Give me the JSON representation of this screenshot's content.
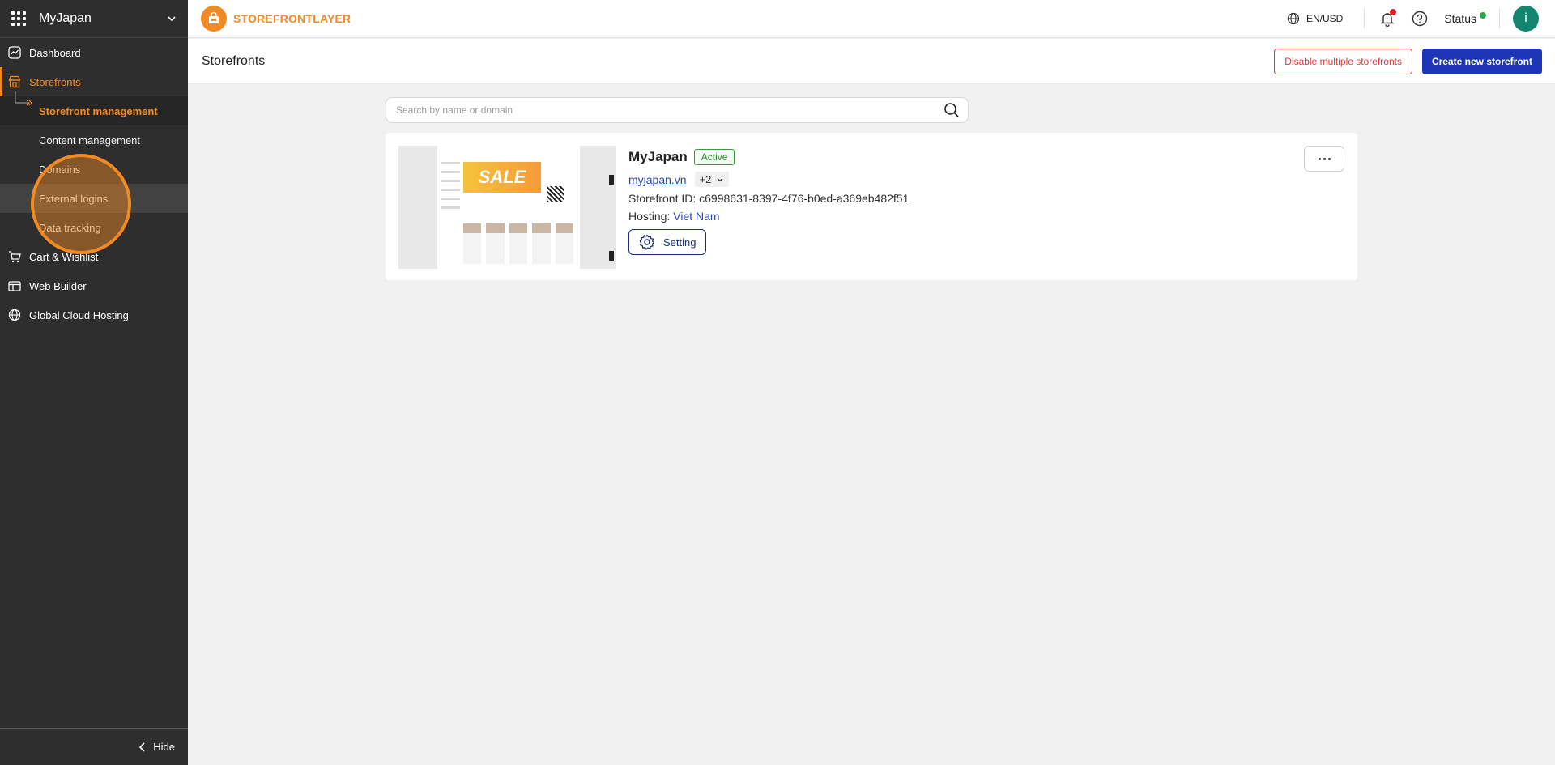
{
  "workspace": {
    "name": "MyJapan"
  },
  "sidebar": {
    "items": [
      {
        "label": "Dashboard",
        "icon": "chart-icon"
      },
      {
        "label": "Storefronts",
        "icon": "store-icon"
      },
      {
        "label": "Cart & Wishlist",
        "icon": "cart-icon"
      },
      {
        "label": "Web Builder",
        "icon": "builder-icon"
      },
      {
        "label": "Global Cloud Hosting",
        "icon": "globe-icon"
      }
    ],
    "sub_items": [
      {
        "label": "Storefront management"
      },
      {
        "label": "Content management"
      },
      {
        "label": "Domains"
      },
      {
        "label": "External logins"
      },
      {
        "label": "Data tracking"
      }
    ],
    "hide_label": "Hide"
  },
  "topbar": {
    "brand": "STOREFRONTLAYER",
    "locale": "EN/USD",
    "status_label": "Status",
    "avatar_initial": "i"
  },
  "header": {
    "title": "Storefronts",
    "disable_label": "Disable multiple storefronts",
    "create_label": "Create new storefront"
  },
  "search": {
    "placeholder": "Search by name or domain"
  },
  "storefront": {
    "name": "MyJapan",
    "status": "Active",
    "domain": "myjapan.vn",
    "more_domains": "+2",
    "id_line": "Storefront ID: c6998631-8397-4f76-b0ed-a369eb482f51",
    "hosting_label": "Hosting:",
    "hosting_value": "Viet Nam",
    "setting_label": "Setting",
    "thumb_text": "SALE"
  },
  "colors": {
    "accent": "#f08a24",
    "primary": "#1d36b8",
    "danger": "#d63a3a",
    "sidebar": "#2e2e2e"
  }
}
